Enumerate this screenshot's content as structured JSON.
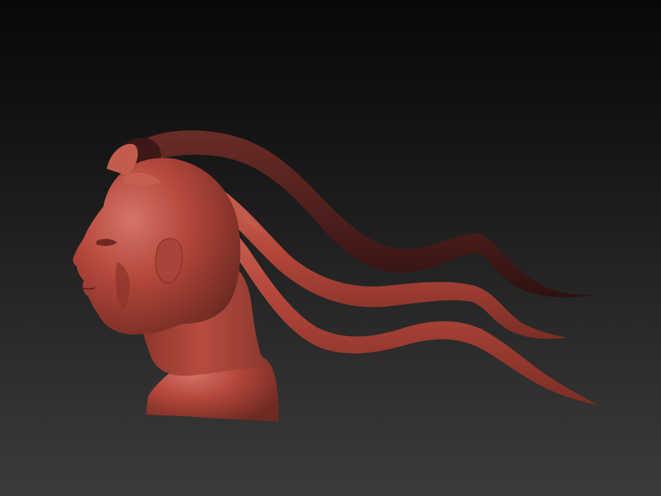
{
  "viewport": {
    "background_top": "#080808",
    "background_bottom": "#3b3b3b"
  },
  "model": {
    "material_color": "#b5473b",
    "shadow_color": "#6b2a23",
    "highlight_color": "#d8796b",
    "dark_tendril_color": "#4e1f1c"
  }
}
